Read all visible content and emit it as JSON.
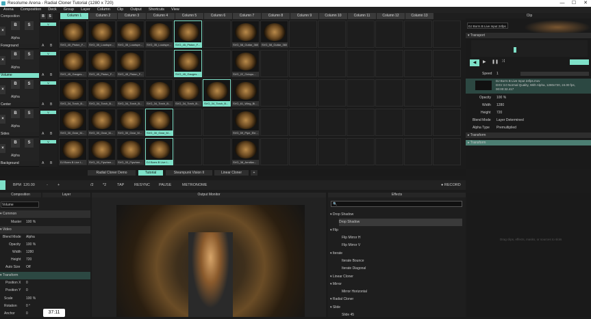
{
  "window": {
    "title": "Resolume Arena - Radial Cloner Tutorial (1280 x 720)",
    "minimize": "—",
    "maximize": "☐",
    "close": "✕"
  },
  "menu": [
    "Arena",
    "Composition",
    "Deck",
    "Group",
    "Layer",
    "Column",
    "Clip",
    "Output",
    "Shortcuts",
    "View"
  ],
  "columns": [
    "Column 1",
    "Column 2",
    "Column 3",
    "Column 4",
    "Column 5",
    "Column 6",
    "Column 7",
    "Column 8",
    "Column 9",
    "Column 10",
    "Column 11",
    "Column 12",
    "Column 13"
  ],
  "composition_label": "Composition",
  "clip_label": "Clip",
  "layers": [
    {
      "name": "Foreground",
      "clips": [
        {
          "col": 0,
          "label": "SVG_40_Piston_F..."
        },
        {
          "col": 1,
          "label": "SVG_35_Loudspe..."
        },
        {
          "col": 2,
          "label": "SVG_35_Loudspe..."
        },
        {
          "col": 3,
          "label": "SVG_35_Loudspe..."
        },
        {
          "col": 4,
          "label": "SVG_45_Piston_F..."
        },
        {
          "col": 6,
          "label": "SVG_58_Guitar_360"
        },
        {
          "col": 7,
          "label": "SVG_58_Guitar_360"
        }
      ]
    },
    {
      "name": "Volume",
      "clips": [
        {
          "col": 0,
          "label": "SVG_45_Gauges..."
        },
        {
          "col": 1,
          "label": "SVG_45_Piston_F..."
        },
        {
          "col": 2,
          "label": "SVG_45_Piston_F..."
        },
        {
          "col": 4,
          "label": "SVG_45_Gauges..."
        },
        {
          "col": 6,
          "label": "SVG_22_Octopu..."
        }
      ]
    },
    {
      "name": "Center",
      "clips": [
        {
          "col": 0,
          "label": "SVG_34_Torch_B..."
        },
        {
          "col": 1,
          "label": "SVG_34_Torch_B..."
        },
        {
          "col": 2,
          "label": "SVG_34_Torch_B..."
        },
        {
          "col": 3,
          "label": "SVG_34_Torch_B..."
        },
        {
          "col": 4,
          "label": "SVG_34_Torch_B..."
        },
        {
          "col": 5,
          "label": "SVG_34_Torch_B..."
        },
        {
          "col": 6,
          "label": "SVG_61_Wing_Bi..."
        }
      ]
    },
    {
      "name": "Sides",
      "clips": [
        {
          "col": 0,
          "label": "SVG_30_Gear_M..."
        },
        {
          "col": 1,
          "label": "SVG_30_Gear_M..."
        },
        {
          "col": 2,
          "label": "SVG_30_Gear_M..."
        },
        {
          "col": 3,
          "label": "SVG_30_Gear_M..."
        },
        {
          "col": 6,
          "label": "SVG_59_Pipe_Ele..."
        }
      ]
    },
    {
      "name": "Background",
      "clips": [
        {
          "col": 0,
          "label": "DJ Borrs B Live I..."
        },
        {
          "col": 1,
          "label": "SVG_33_Flywhee..."
        },
        {
          "col": 2,
          "label": "SVG_33_Flywhee..."
        },
        {
          "col": 3,
          "label": "DJ Borrs B Live I..."
        },
        {
          "col": 6,
          "label": "SVG_38_Armillar..."
        }
      ]
    }
  ],
  "layer_buttons": {
    "x": "×",
    "b": "B",
    "s": "S",
    "v": "V",
    "a": "A",
    "bb": "B",
    "alpha": "Alpha"
  },
  "deck_tabs": [
    "Radial Cloner Demo",
    "Tutorial",
    "Steampunk Vision II",
    "Linear Cloner"
  ],
  "deck_active": "Tutorial",
  "deck_add": "+",
  "transport": {
    "bpm_label": "BPM",
    "bpm": "120.00",
    "minus": "-",
    "plus": "+",
    "tap": "TAP",
    "resync": "RESYNC",
    "pause": "PAUSE",
    "metronome": "METRONOME",
    "record": "● RECORD",
    "div": "/2",
    "mul": "*2"
  },
  "left_panel": {
    "tab_composition": "Composition",
    "tab_layer": "Layer",
    "title": "Volume",
    "common": "▾ Common",
    "master_label": "Master",
    "master": "100 %",
    "video": "▾ Video",
    "blend_label": "Blend Mode",
    "blend": "Alpha",
    "opacity_label": "Opacity",
    "opacity": "100 %",
    "width_label": "Width",
    "width": "1280",
    "height_label": "Height",
    "height": "720",
    "autosize_label": "Auto Size",
    "autosize": "Off",
    "transform": "▾ Transform",
    "posx_label": "Position X",
    "posx": "0",
    "posy_label": "Position Y",
    "posy": "0",
    "scale_label": "Scale",
    "scale": "100 %",
    "rotation_label": "Rotation",
    "rotation": "0 °",
    "anchor_label": "Anchor",
    "anchor": "0"
  },
  "output_monitor": {
    "title": "Output Monitor"
  },
  "effects": {
    "title": "Effects",
    "search": "🔍 ",
    "items": [
      "▾ Drop Shadow",
      "Drop Shadow",
      "▾ Flip",
      "Flip Mirror H",
      "Flip Mirror V",
      "▾ Iterate",
      "Iterate Bounce",
      "Iterate Diagonal",
      "▾ Linear Cloner",
      "▾ Mirror",
      "Mirror Horizontal",
      "▾ Radial Cloner",
      "▾ Slide",
      "Slide 45"
    ],
    "hint": "Drag clips, effects, masks, or sources to slots"
  },
  "clip_panel": {
    "source": "DJ Borrs B Live Input 24fps",
    "transport": "▾ Transport",
    "speed_label": "Speed",
    "speed": "1",
    "clip_name": "DJ Borrs B Live Input 24fps.mov",
    "clip_info": "DXV 3.0 Normal Quality, With Alpha, 1280x720, 24.00 fps, 00:00:32.417",
    "opacity_label": "Opacity",
    "opacity": "100 %",
    "width_label": "Width",
    "width": "1280",
    "height_label": "Height",
    "height": "720",
    "blend_label": "Blend Mode",
    "blend": "Layer Determined",
    "alpha_label": "Alpha Type",
    "alpha": "Premultiplied",
    "transform1": "▸ Transform",
    "transform2": "▸ Transform"
  },
  "timecode": "37:11"
}
